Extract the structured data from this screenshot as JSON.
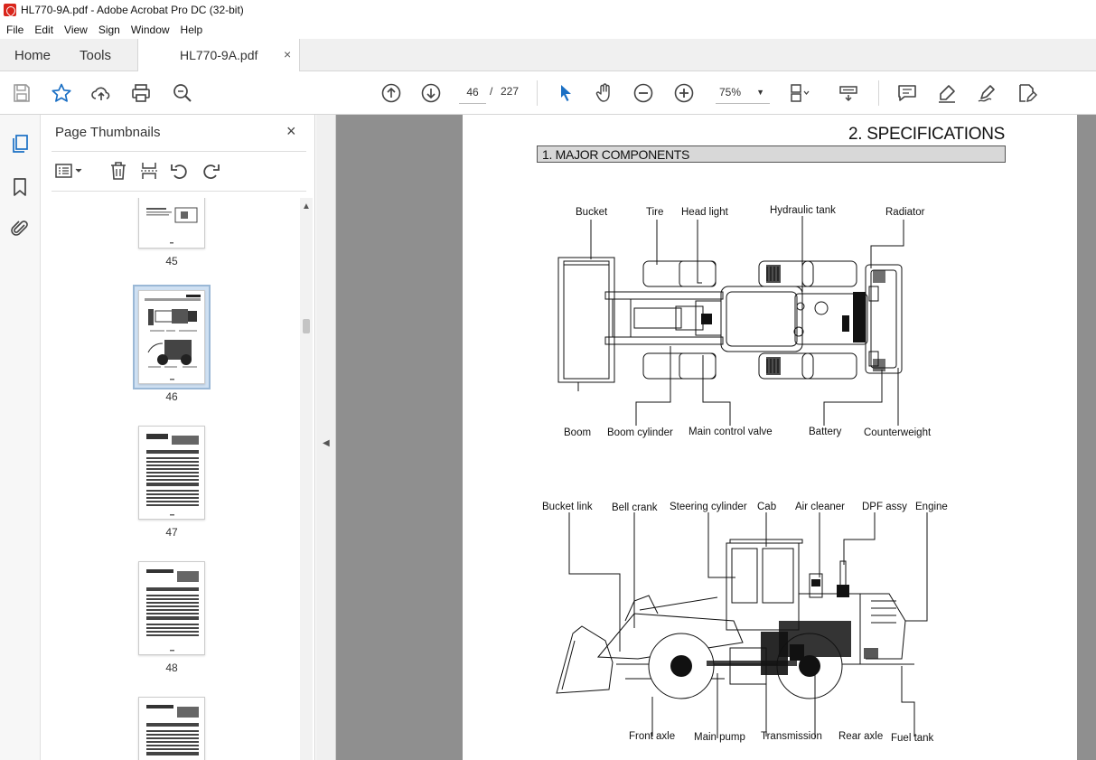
{
  "window": {
    "title": "HL770-9A.pdf - Adobe Acrobat Pro DC (32-bit)"
  },
  "menu": [
    "File",
    "Edit",
    "View",
    "Sign",
    "Window",
    "Help"
  ],
  "tabs": {
    "home": "Home",
    "tools": "Tools",
    "document": "HL770-9A.pdf",
    "close_glyph": "×"
  },
  "navigation": {
    "current_page": "46",
    "separator": "/",
    "total_pages": "227",
    "zoom": "75%"
  },
  "panel": {
    "title": "Page Thumbnails",
    "close_glyph": "×",
    "thumbnails": [
      {
        "page": "45",
        "selected": false
      },
      {
        "page": "46",
        "selected": true
      },
      {
        "page": "47",
        "selected": false
      },
      {
        "page": "48",
        "selected": false
      }
    ]
  },
  "document": {
    "heading": "2. SPECIFICATIONS",
    "section": "1. MAJOR COMPONENTS",
    "top_view_labels": {
      "bucket": "Bucket",
      "tire": "Tire",
      "head_light": "Head light",
      "hydraulic_tank": "Hydraulic tank",
      "radiator": "Radiator",
      "boom": "Boom",
      "boom_cylinder": "Boom cylinder",
      "main_control_valve": "Main control valve",
      "battery": "Battery",
      "counterweight": "Counterweight"
    },
    "side_view_labels": {
      "bucket_link": "Bucket link",
      "bell_crank": "Bell crank",
      "steering_cylinder": "Steering cylinder",
      "cab": "Cab",
      "air_cleaner": "Air cleaner",
      "dpf_assy": "DPF assy",
      "engine": "Engine",
      "front_axle": "Front axle",
      "main_pump": "Main pump",
      "transmission": "Transmission",
      "rear_axle": "Rear axle",
      "fuel_tank": "Fuel tank"
    }
  },
  "colors": {
    "accent_blue": "#1a6fc4",
    "acrobat_red": "#d9261c",
    "viewport_gray": "#8f8f8f"
  }
}
